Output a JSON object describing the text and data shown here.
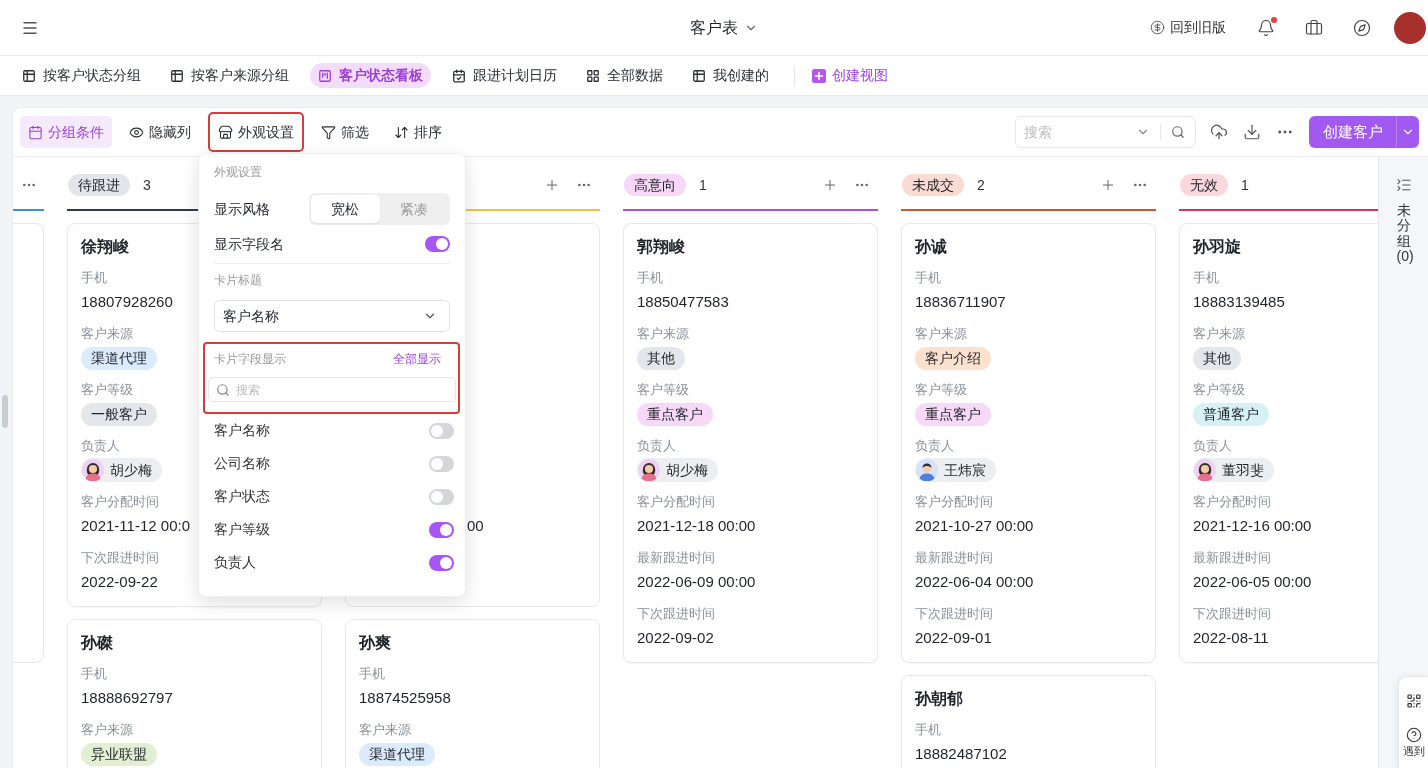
{
  "header": {
    "title": "客户表",
    "legacy_link": "回到旧版",
    "unread_notifications": true
  },
  "view_tabs": [
    {
      "label": "按客户状态分组",
      "kind": "table",
      "selected": false
    },
    {
      "label": "按客户来源分组",
      "kind": "table",
      "selected": false
    },
    {
      "label": "客户状态看板",
      "kind": "kanban",
      "selected": true
    },
    {
      "label": "跟进计划日历",
      "kind": "calendar",
      "selected": false
    },
    {
      "label": "全部数据",
      "kind": "grid",
      "selected": false
    },
    {
      "label": "我创建的",
      "kind": "table",
      "selected": false
    }
  ],
  "create_view": "创建视图",
  "toolbar": {
    "items": [
      {
        "label": "分组条件",
        "kind": "group",
        "selected": true,
        "highlighted": false
      },
      {
        "label": "隐藏列",
        "kind": "hide",
        "selected": false,
        "highlighted": false
      },
      {
        "label": "外观设置",
        "kind": "appearance",
        "selected": false,
        "highlighted": true
      },
      {
        "label": "筛选",
        "kind": "filter",
        "selected": false,
        "highlighted": false
      },
      {
        "label": "排序",
        "kind": "sort",
        "selected": false,
        "highlighted": false
      }
    ],
    "search": {
      "placeholder": "搜索"
    },
    "create_button": "创建客户"
  },
  "board": {
    "columns": [
      {
        "kind": "partial",
        "color": "#3f8fdc",
        "show_add": false,
        "show_more": true,
        "cards": [
          {
            "kind": "edge"
          }
        ]
      },
      {
        "kind": "full",
        "tag": {
          "label": "待跟进",
          "color": "#e2e5e9"
        },
        "count": "3",
        "color": "#2e3c4b",
        "cards": [
          {
            "kind": "full",
            "title": "徐翔峻",
            "fields": [
              {
                "label": "手机",
                "kind": "text",
                "value": "18807928260"
              },
              {
                "label": "客户来源",
                "kind": "tag",
                "value": "渠道代理",
                "color": "#dcebfb"
              },
              {
                "label": "客户等级",
                "kind": "tag",
                "value": "一般客户",
                "color": "#e3e6ea"
              },
              {
                "label": "负责人",
                "kind": "person",
                "value": "胡少梅",
                "avatar": {
                  "kind": "female"
                }
              },
              {
                "label": "客户分配时间",
                "kind": "text",
                "value": "2021-11-12 00:0"
              },
              {
                "label": "下次跟进时间",
                "kind": "text",
                "value": "2022-09-22"
              }
            ]
          },
          {
            "kind": "full",
            "title": "孙磔",
            "fields": [
              {
                "label": "手机",
                "kind": "text",
                "value": "18888692797"
              },
              {
                "label": "客户来源",
                "kind": "tag",
                "value": "异业联盟",
                "color": "#e3efd3"
              }
            ]
          }
        ]
      },
      {
        "kind": "full",
        "color": "#f2c142",
        "show_add": true,
        "show_more": true,
        "cards": [
          {
            "kind": "covered",
            "visible_text": "00"
          },
          {
            "kind": "full",
            "title": "孙爽",
            "fields": [
              {
                "label": "手机",
                "kind": "text",
                "value": "18874525958"
              },
              {
                "label": "客户来源",
                "kind": "tag",
                "value": "渠道代理",
                "color": "#dcebfb"
              }
            ]
          }
        ]
      },
      {
        "kind": "full",
        "tag": {
          "label": "高意向",
          "color": "#f6d8f6"
        },
        "count": "1",
        "color": "#b54fd1",
        "show_add": true,
        "show_more": true,
        "cards": [
          {
            "kind": "full",
            "title": "郭翔峻",
            "fields": [
              {
                "label": "手机",
                "kind": "text",
                "value": "18850477583"
              },
              {
                "label": "客户来源",
                "kind": "tag",
                "value": "其他",
                "color": "#e3e6ea"
              },
              {
                "label": "客户等级",
                "kind": "tag",
                "value": "重点客户",
                "color": "#f7d9f7"
              },
              {
                "label": "负责人",
                "kind": "person",
                "value": "胡少梅",
                "avatar": {
                  "kind": "female"
                }
              },
              {
                "label": "客户分配时间",
                "kind": "text",
                "value": "2021-12-18 00:00"
              },
              {
                "label": "最新跟进时间",
                "kind": "text",
                "value": "2022-06-09 00:00"
              },
              {
                "label": "下次跟进时间",
                "kind": "text",
                "value": "2022-09-02"
              }
            ]
          }
        ]
      },
      {
        "kind": "full",
        "tag": {
          "label": "未成交",
          "color": "#fadbd3"
        },
        "count": "2",
        "color": "#d5532f",
        "show_add": true,
        "show_more": true,
        "cards": [
          {
            "kind": "full",
            "title": "孙诚",
            "fields": [
              {
                "label": "手机",
                "kind": "text",
                "value": "18836711907"
              },
              {
                "label": "客户来源",
                "kind": "tag",
                "value": "客户介绍",
                "color": "#fde1cf"
              },
              {
                "label": "客户等级",
                "kind": "tag",
                "value": "重点客户",
                "color": "#f7d9f7"
              },
              {
                "label": "负责人",
                "kind": "person",
                "value": "王炜宸",
                "avatar": {
                  "kind": "male"
                }
              },
              {
                "label": "客户分配时间",
                "kind": "text",
                "value": "2021-10-27 00:00"
              },
              {
                "label": "最新跟进时间",
                "kind": "text",
                "value": "2022-06-04 00:00"
              },
              {
                "label": "下次跟进时间",
                "kind": "text",
                "value": "2022-09-01"
              }
            ]
          },
          {
            "kind": "full",
            "title": "孙朝郁",
            "fields": [
              {
                "label": "手机",
                "kind": "text",
                "value": "18882487102"
              }
            ]
          }
        ]
      },
      {
        "kind": "full",
        "tag": {
          "label": "无效",
          "color": "#fbd7de"
        },
        "count": "1",
        "color": "#d4355b",
        "cards": [
          {
            "kind": "full",
            "title": "孙羽旋",
            "fields": [
              {
                "label": "手机",
                "kind": "text",
                "value": "18883139485"
              },
              {
                "label": "客户来源",
                "kind": "tag",
                "value": "其他",
                "color": "#e3e6ea"
              },
              {
                "label": "客户等级",
                "kind": "tag",
                "value": "普通客户",
                "color": "#d6f1f6"
              },
              {
                "label": "负责人",
                "kind": "person",
                "value": "董羽斐",
                "avatar": {
                  "kind": "female"
                }
              },
              {
                "label": "客户分配时间",
                "kind": "text",
                "value": "2021-12-16 00:00"
              },
              {
                "label": "最新跟进时间",
                "kind": "text",
                "value": "2022-06-05 00:00"
              },
              {
                "label": "下次跟进时间",
                "kind": "text",
                "value": "2022-08-11"
              }
            ]
          }
        ]
      }
    ],
    "ungrouped": "未分组 (0)"
  },
  "appearance_popover": {
    "title": "外观设置",
    "style_label": "显示风格",
    "style_options": [
      {
        "label": "宽松",
        "selected": true
      },
      {
        "label": "紧凑",
        "selected": false
      }
    ],
    "show_field_names": {
      "label": "显示字段名",
      "on": true
    },
    "card_title_label": "卡片标题",
    "card_title_select": {
      "value": "客户名称"
    },
    "field_display": {
      "label": "卡片字段显示",
      "show_all": "全部显示",
      "search": {
        "placeholder": "搜索"
      },
      "highlighted": true
    },
    "fields": [
      {
        "label": "客户名称",
        "on": false
      },
      {
        "label": "公司名称",
        "on": false
      },
      {
        "label": "客户状态",
        "on": false
      },
      {
        "label": "客户等级",
        "on": true
      },
      {
        "label": "负责人",
        "on": true
      }
    ]
  },
  "help_widget": {
    "label": "遇到"
  }
}
